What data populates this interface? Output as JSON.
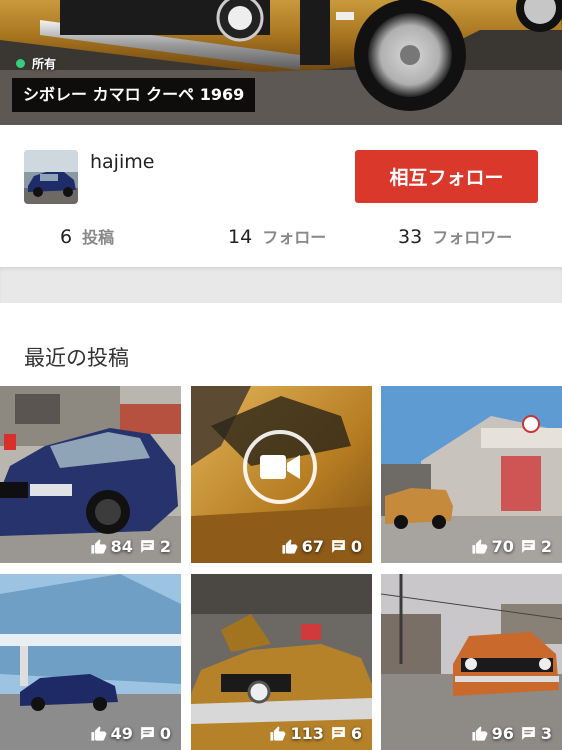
{
  "hero": {
    "status_label": "所有",
    "car_title": "シボレー カマロ クーペ 1969"
  },
  "profile": {
    "username": "hajime",
    "follow_button": "相互フォロー",
    "stats": [
      {
        "value": "6",
        "label": "投稿"
      },
      {
        "value": "14",
        "label": "フォロー"
      },
      {
        "value": "33",
        "label": "フォロワー"
      }
    ]
  },
  "recent": {
    "title": "最近の投稿",
    "posts": [
      {
        "likes": "84",
        "comments": "2",
        "video": false
      },
      {
        "likes": "67",
        "comments": "0",
        "video": true
      },
      {
        "likes": "70",
        "comments": "2",
        "video": false
      },
      {
        "likes": "49",
        "comments": "0",
        "video": false
      },
      {
        "likes": "113",
        "comments": "6",
        "video": false
      },
      {
        "likes": "96",
        "comments": "3",
        "video": false
      }
    ]
  },
  "colors": {
    "accent": "#d9382b",
    "status_dot": "#35d07f"
  },
  "icons": [
    "thumbs-up-icon",
    "comment-icon",
    "video-camera-icon",
    "status-dot-icon"
  ]
}
